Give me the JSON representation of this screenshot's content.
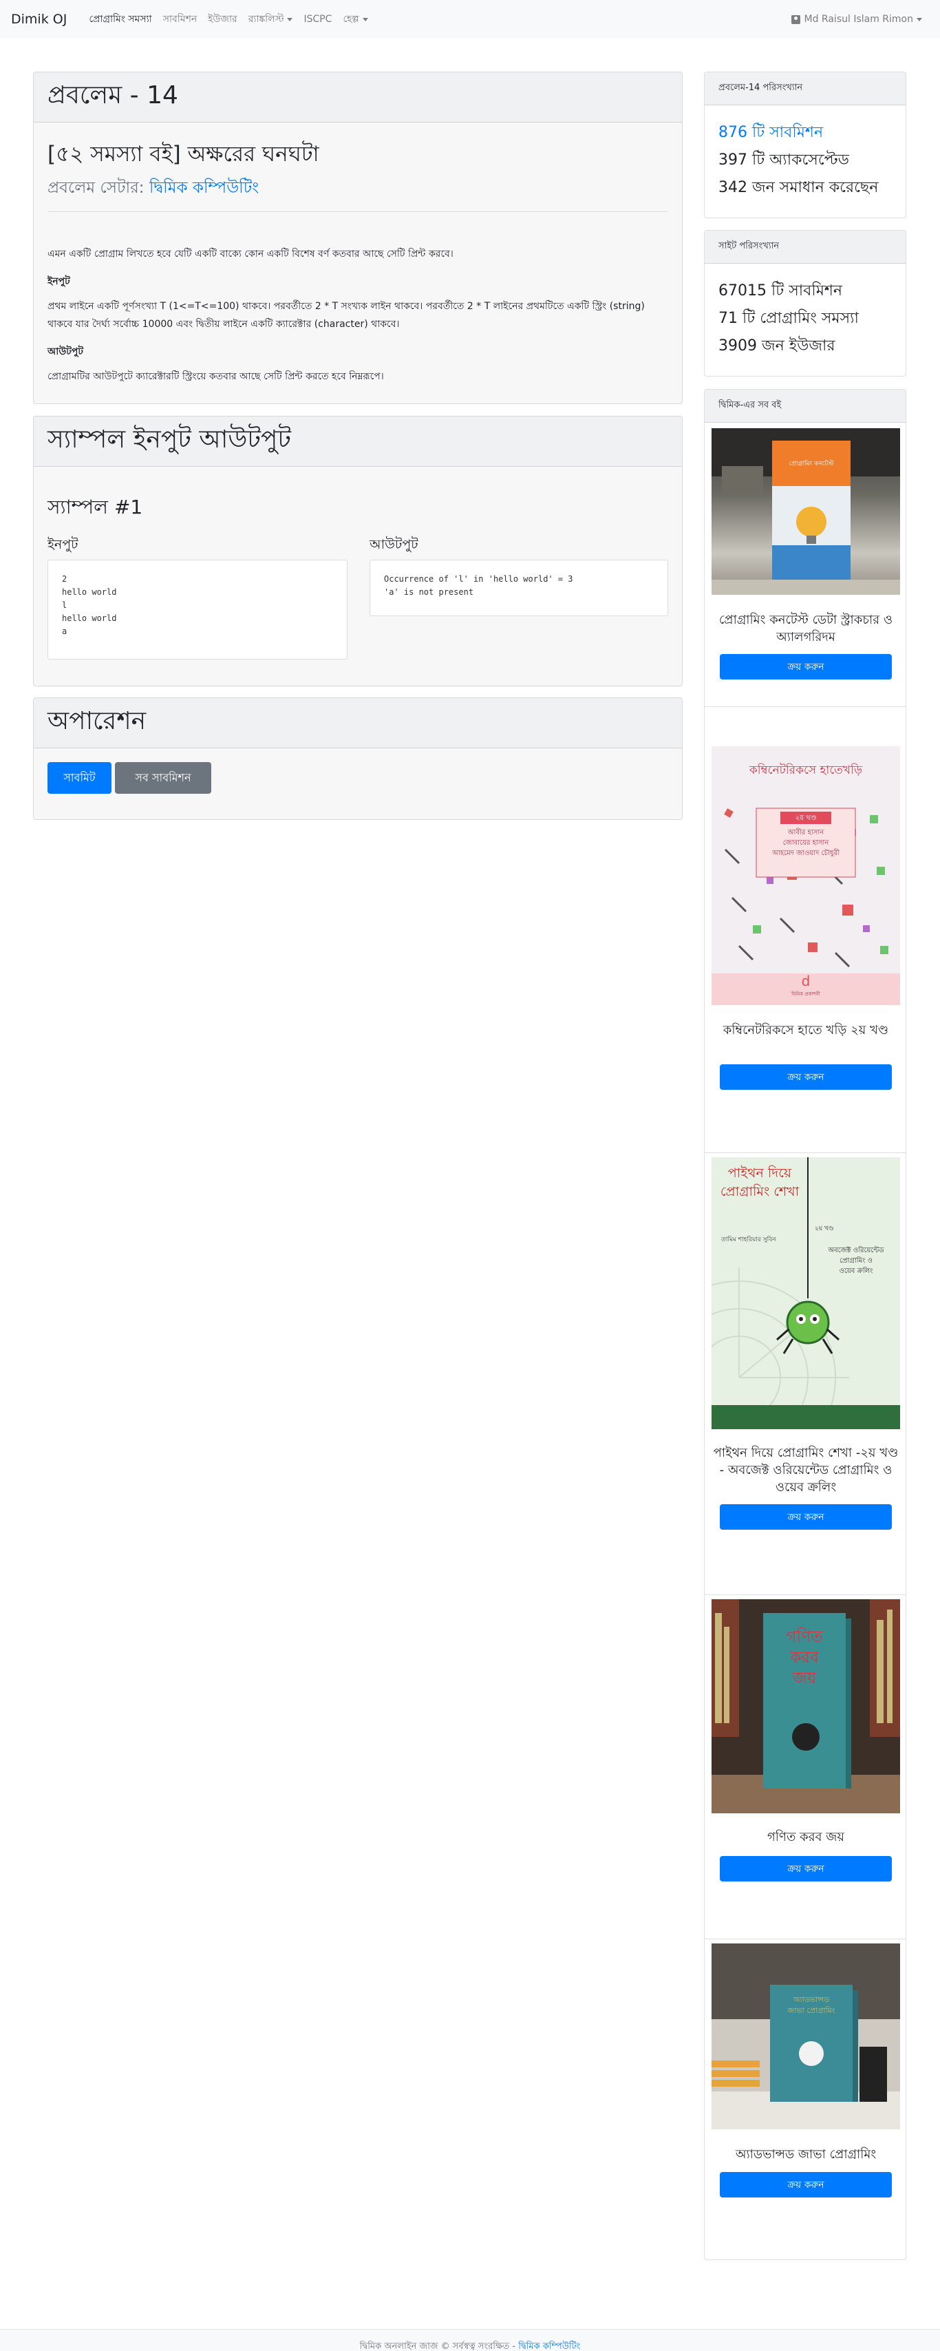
{
  "nav": {
    "brand": "Dimik OJ",
    "links": [
      "প্রোগ্রামিং সমস্যা",
      "সাবমিশন",
      "ইউজার",
      "র‍্যাঙ্কলিস্ট",
      "ISCPC",
      "হেল্প"
    ],
    "user": "Md Raisul Islam Rimon"
  },
  "problem": {
    "header": "প্রবলেম - 14",
    "title": "[৫২ সমস্যা বই] অক্ষরের ঘনঘটা",
    "setter_label": "প্রবলেম সেটার:",
    "setter_name": "দ্বিমিক কম্পিউটিং",
    "statement": "এমন একটি প্রোগ্রাম লিখতে হবে যেটি একটি বাক্যে কোন একটি বিশেষ বর্ণ কতবার আছে সেটি প্রিন্ট করবে।",
    "input_heading": "ইনপুট",
    "input_text": "প্রথম লাইনে একটি পূর্ণসংখ্যা T (1<=T<=100) থাকবে। পরবর্তীতে 2 * T সংখ্যক লাইন থাকবে। পরবর্তীতে 2 * T লাইনের প্রথমটিতে একটি স্ট্রিং (string) থাকবে যার দৈর্ঘ্য সর্বোচ্চ 10000 এবং দ্বিতীয় লাইনে একটি ক্যারেক্টার (character) থাকবে।",
    "output_heading": "আউটপুট",
    "output_text": "প্রোগ্রামটির আউটপুটে ক্যারেক্টারটি স্ট্রিংয়ে কতবার আছে সেটি প্রিন্ট করতে হবে নিম্নরূপে।"
  },
  "sample": {
    "header": "স্যাম্পল ইনপুট আউটপুট",
    "title": "স্যাম্পল #1",
    "input_label": "ইনপুট",
    "output_label": "আউটপুট",
    "input": "2\nhello world\nl\nhello world\na",
    "output": "Occurrence of 'l' in 'hello world' = 3\n'a' is not present"
  },
  "operation": {
    "header": "অপারেশন",
    "submit": "সাবমিট",
    "all_submissions": "সব সাবমিশন"
  },
  "problem_stats": {
    "header": "প্রবলেম-14 পরিসংখ্যান",
    "submissions": "876 টি সাবমিশন",
    "accepted": "397 টি অ্যাকসেপ্টেড",
    "solvers": "342 জন সমাধান করেছেন"
  },
  "site_stats": {
    "header": "সাইট পরিসংখ্যান",
    "submissions": "67015 টি সাবমিশন",
    "problems": "71 টি প্রোগ্রামিং সমস্যা",
    "users": "3909 জন ইউজার"
  },
  "books": {
    "header": "দ্বিমিক-এর সব বই",
    "buy_label": "ক্রয় করুন",
    "items": [
      {
        "title": "প্রোগ্রামিং কনটেস্ট ডেটা স্ট্রাকচার ও অ্যালগরিদম",
        "cover_text": "প্রোগ্রামিং কনটেস্ট"
      },
      {
        "title": "কম্বিনেটরিকসে হাতে খড়ি ২য় খণ্ড",
        "cover_text": "কম্বিনেটরিকসে হাতেখড়ি",
        "cover_sub": "২য় খণ্ড",
        "cover_authors": "আবীর হাসান\nজোবায়ের হাসান\nআহমেদ জাওয়াদ চৌধুরী",
        "cover_publisher": "দ্বিমিক প্রকাশনী"
      },
      {
        "title": "পাইথন দিয়ে প্রোগ্রামিং শেখা -২য় খণ্ড - অবজেক্ট ওরিয়েন্টেড প্রোগ্রামিং ও ওয়েব ক্রলিং",
        "cover_text": "পাইথন দিয়ে\nপ্রোগ্রামিং শেখা",
        "cover_sub": "২য় খণ্ড",
        "cover_author": "তামিম শাহরিয়ার সুবিন",
        "cover_topic": "অবজেক্ট ওরিয়েন্টেড\nপ্রোগ্রামিং ও\nওয়েব ক্রলিং"
      },
      {
        "title": "গণিত করব জয়",
        "cover_text": "গণিত\nকরব\nজয়"
      },
      {
        "title": "অ্যাডভান্সড জাভা প্রোগ্রামিং",
        "cover_text": "অ্যাডভান্সড\nজাভা প্রোগ্রামিং"
      }
    ]
  },
  "footer": {
    "text": "দ্বিমিক অনলাইন জাজ © সর্বস্বত্ব সংরক্ষিত -",
    "link": "দ্বিমিক কম্পিউটিং"
  },
  "colors": {
    "primary": "#007bff",
    "secondary": "#6c757d",
    "card_header": "#f0f1f3"
  }
}
